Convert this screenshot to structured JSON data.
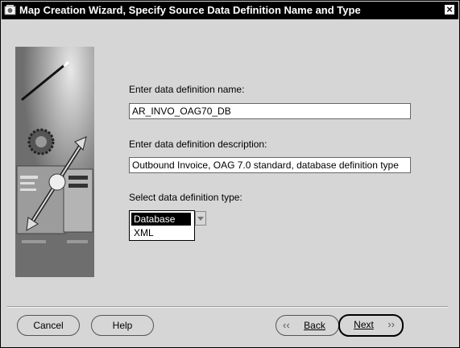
{
  "window": {
    "title": "Map Creation Wizard, Specify Source Data Definition Name and Type",
    "close_glyph": "×"
  },
  "form": {
    "name_label": "Enter data definition name:",
    "name_value": "AR_INVO_OAG70_DB",
    "description_label": "Enter data definition description:",
    "description_value": "Outbound Invoice, OAG 7.0 standard, database definition type",
    "type_label": "Select data definition type:",
    "type_options": [
      "Database",
      "XML"
    ],
    "type_selected": "Database"
  },
  "buttons": {
    "cancel": "Cancel",
    "help": "Help",
    "back": "Back",
    "next": "Next"
  },
  "icons": {
    "back": "chevron-left-double-icon",
    "next": "chevron-right-double-icon"
  }
}
